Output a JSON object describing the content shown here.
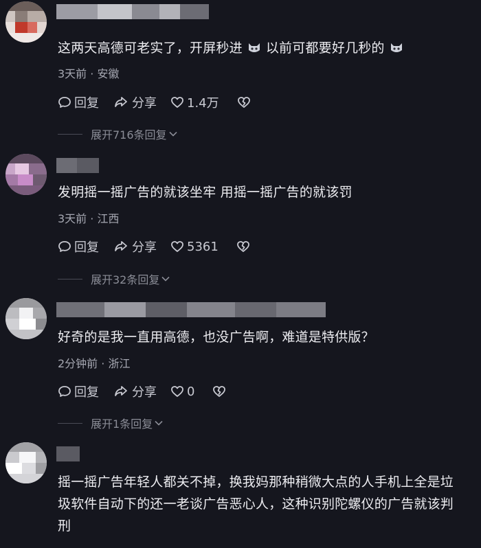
{
  "comments": [
    {
      "text_parts": [
        "这两天高德可老实了，开屏秒进",
        "以前可都要好几秒的"
      ],
      "emoji": "cat-face-icon",
      "meta": "3天前 · 安徽",
      "reply_label": "回复",
      "share_label": "分享",
      "likes": "1.4万",
      "expand_label": "展开716条回复"
    },
    {
      "text": "发明摇一摇广告的就该坐牢 用摇一摇广告的就该罚",
      "meta": "3天前 · 江西",
      "reply_label": "回复",
      "share_label": "分享",
      "likes": "5361",
      "expand_label": "展开32条回复"
    },
    {
      "text": "好奇的是我一直用高德，也没广告啊，难道是特供版？",
      "meta": "2分钟前 · 浙江",
      "reply_label": "回复",
      "share_label": "分享",
      "likes": "0",
      "expand_label": "展开1条回复"
    },
    {
      "text": "摇一摇广告年轻人都关不掉，换我妈那种稍微大点的人手机上全是垃圾软件自动下的还一老谈广告恶心人，这种识别陀螺仪的广告就该判刑"
    }
  ],
  "colors": {
    "background": "#15161e",
    "text": "#ececf0",
    "meta": "#a6a8b2",
    "expand": "#8b8d97"
  }
}
